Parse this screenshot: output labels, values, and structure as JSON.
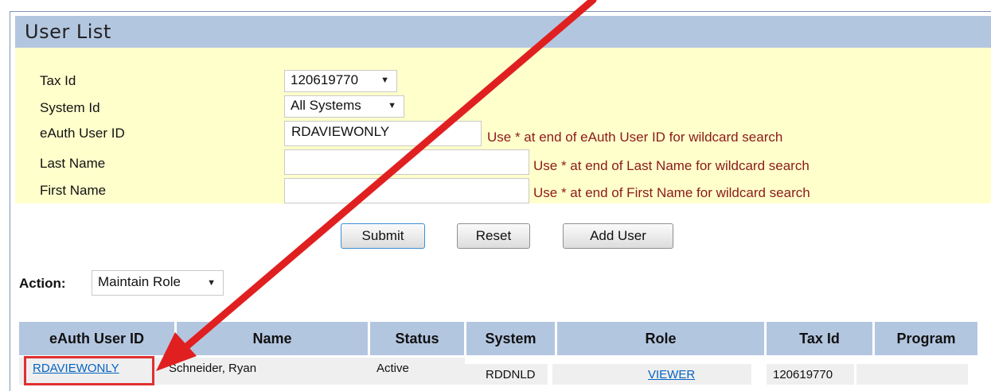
{
  "page": {
    "title": "User List"
  },
  "filters": {
    "tax_id": {
      "label": "Tax Id",
      "value": "120619770"
    },
    "system_id": {
      "label": "System Id",
      "value": "All Systems"
    },
    "eauth_user_id": {
      "label": "eAuth User ID",
      "value": "RDAVIEWONLY",
      "hint": "Use * at end of eAuth User ID for wildcard search"
    },
    "last_name": {
      "label": "Last Name",
      "value": "",
      "hint": "Use * at end of Last Name for wildcard search"
    },
    "first_name": {
      "label": "First Name",
      "value": "",
      "hint": "Use * at end of First Name for wildcard search"
    }
  },
  "buttons": {
    "submit": "Submit",
    "reset": "Reset",
    "add_user": "Add User"
  },
  "action": {
    "label": "Action:",
    "value": "Maintain Role"
  },
  "table": {
    "columns": [
      "eAuth User ID",
      "Name",
      "Status",
      "System",
      "Role",
      "Tax Id",
      "Program"
    ],
    "rows": [
      {
        "eauth_user_id": "RDAVIEWONLY",
        "name": "Schneider, Ryan",
        "status": "Active",
        "system": "RDDNLD",
        "role": "VIEWER",
        "tax_id": "120619770",
        "program": ""
      }
    ]
  },
  "colors": {
    "header_blue": "#b3c6e0",
    "panel_yellow": "#ffffcc",
    "hint_red": "#8b1a1a",
    "link_blue": "#0563c1",
    "annotation_red": "#e02020"
  },
  "icons": {
    "dropdown": "caret-down-icon",
    "annotation": "red-arrow-icon"
  }
}
